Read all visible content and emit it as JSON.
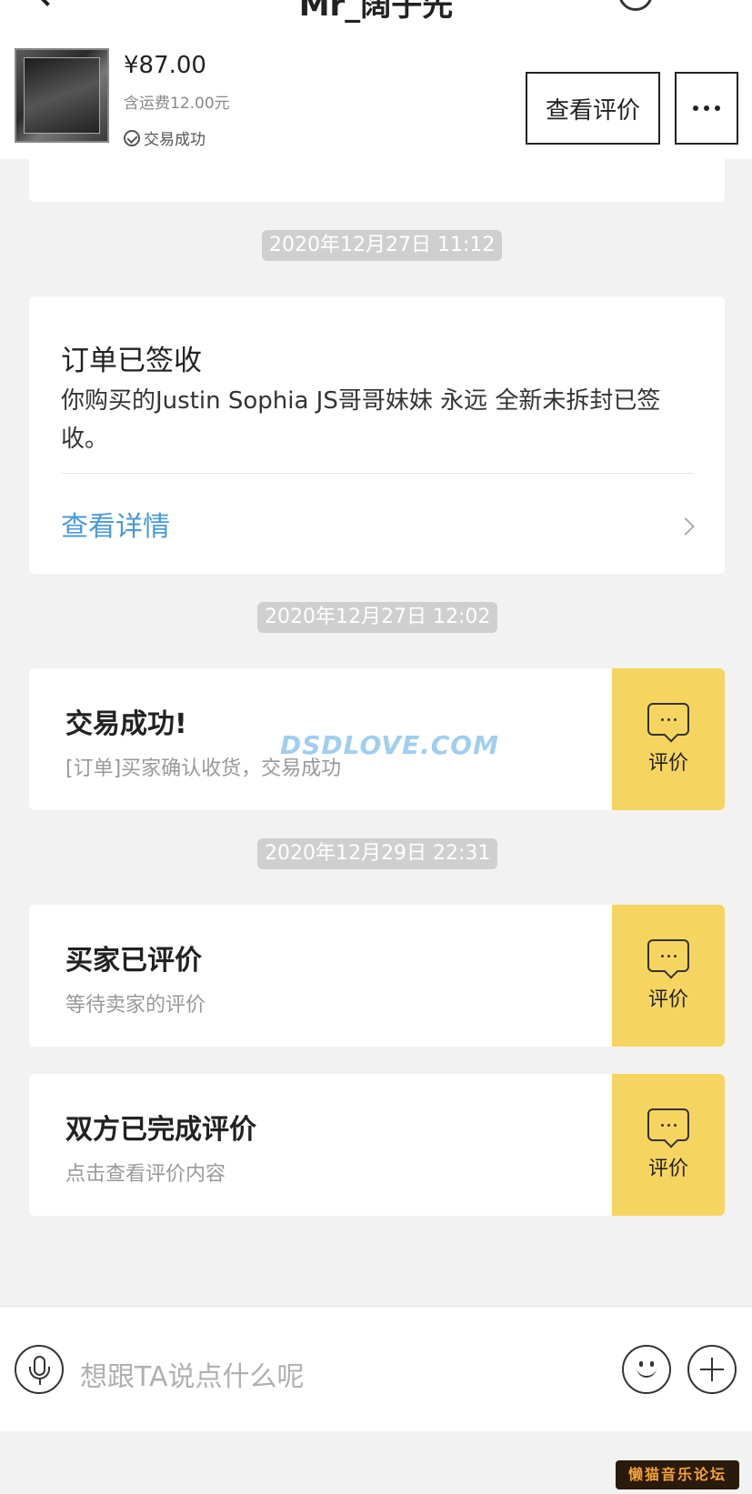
{
  "nav": {
    "title": "Mr_阔子先"
  },
  "product": {
    "price": "¥87.00",
    "shipping": "含运费12.00元",
    "status": "交易成功",
    "review_button": "查看评价"
  },
  "messages": {
    "ts1": "2020年12月27日 11:12",
    "order_card": {
      "heading": "订单已签收",
      "body": "你购买的Justin Sophia JS哥哥妹妹 永远 全新未拆封已签收。",
      "link": "查看详情"
    },
    "ts2": "2020年12月27日 12:02",
    "event1": {
      "title": "交易成功!",
      "subtitle": "[订单]买家确认收货，交易成功",
      "action": "评价"
    },
    "ts3": "2020年12月29日 22:31",
    "event2": {
      "title": "买家已评价",
      "subtitle": "等待卖家的评价",
      "action": "评价"
    },
    "event3": {
      "title": "双方已完成评价",
      "subtitle": "点击查看评价内容",
      "action": "评价"
    }
  },
  "watermark": "DSDLOVE.COM",
  "input": {
    "placeholder": "想跟TA说点什么呢"
  },
  "forum_badge": "懒猫音乐论坛",
  "colors": {
    "accent_yellow": "#f5d55f",
    "link_blue": "#4a9ad8",
    "background": "#f2f2f2"
  }
}
